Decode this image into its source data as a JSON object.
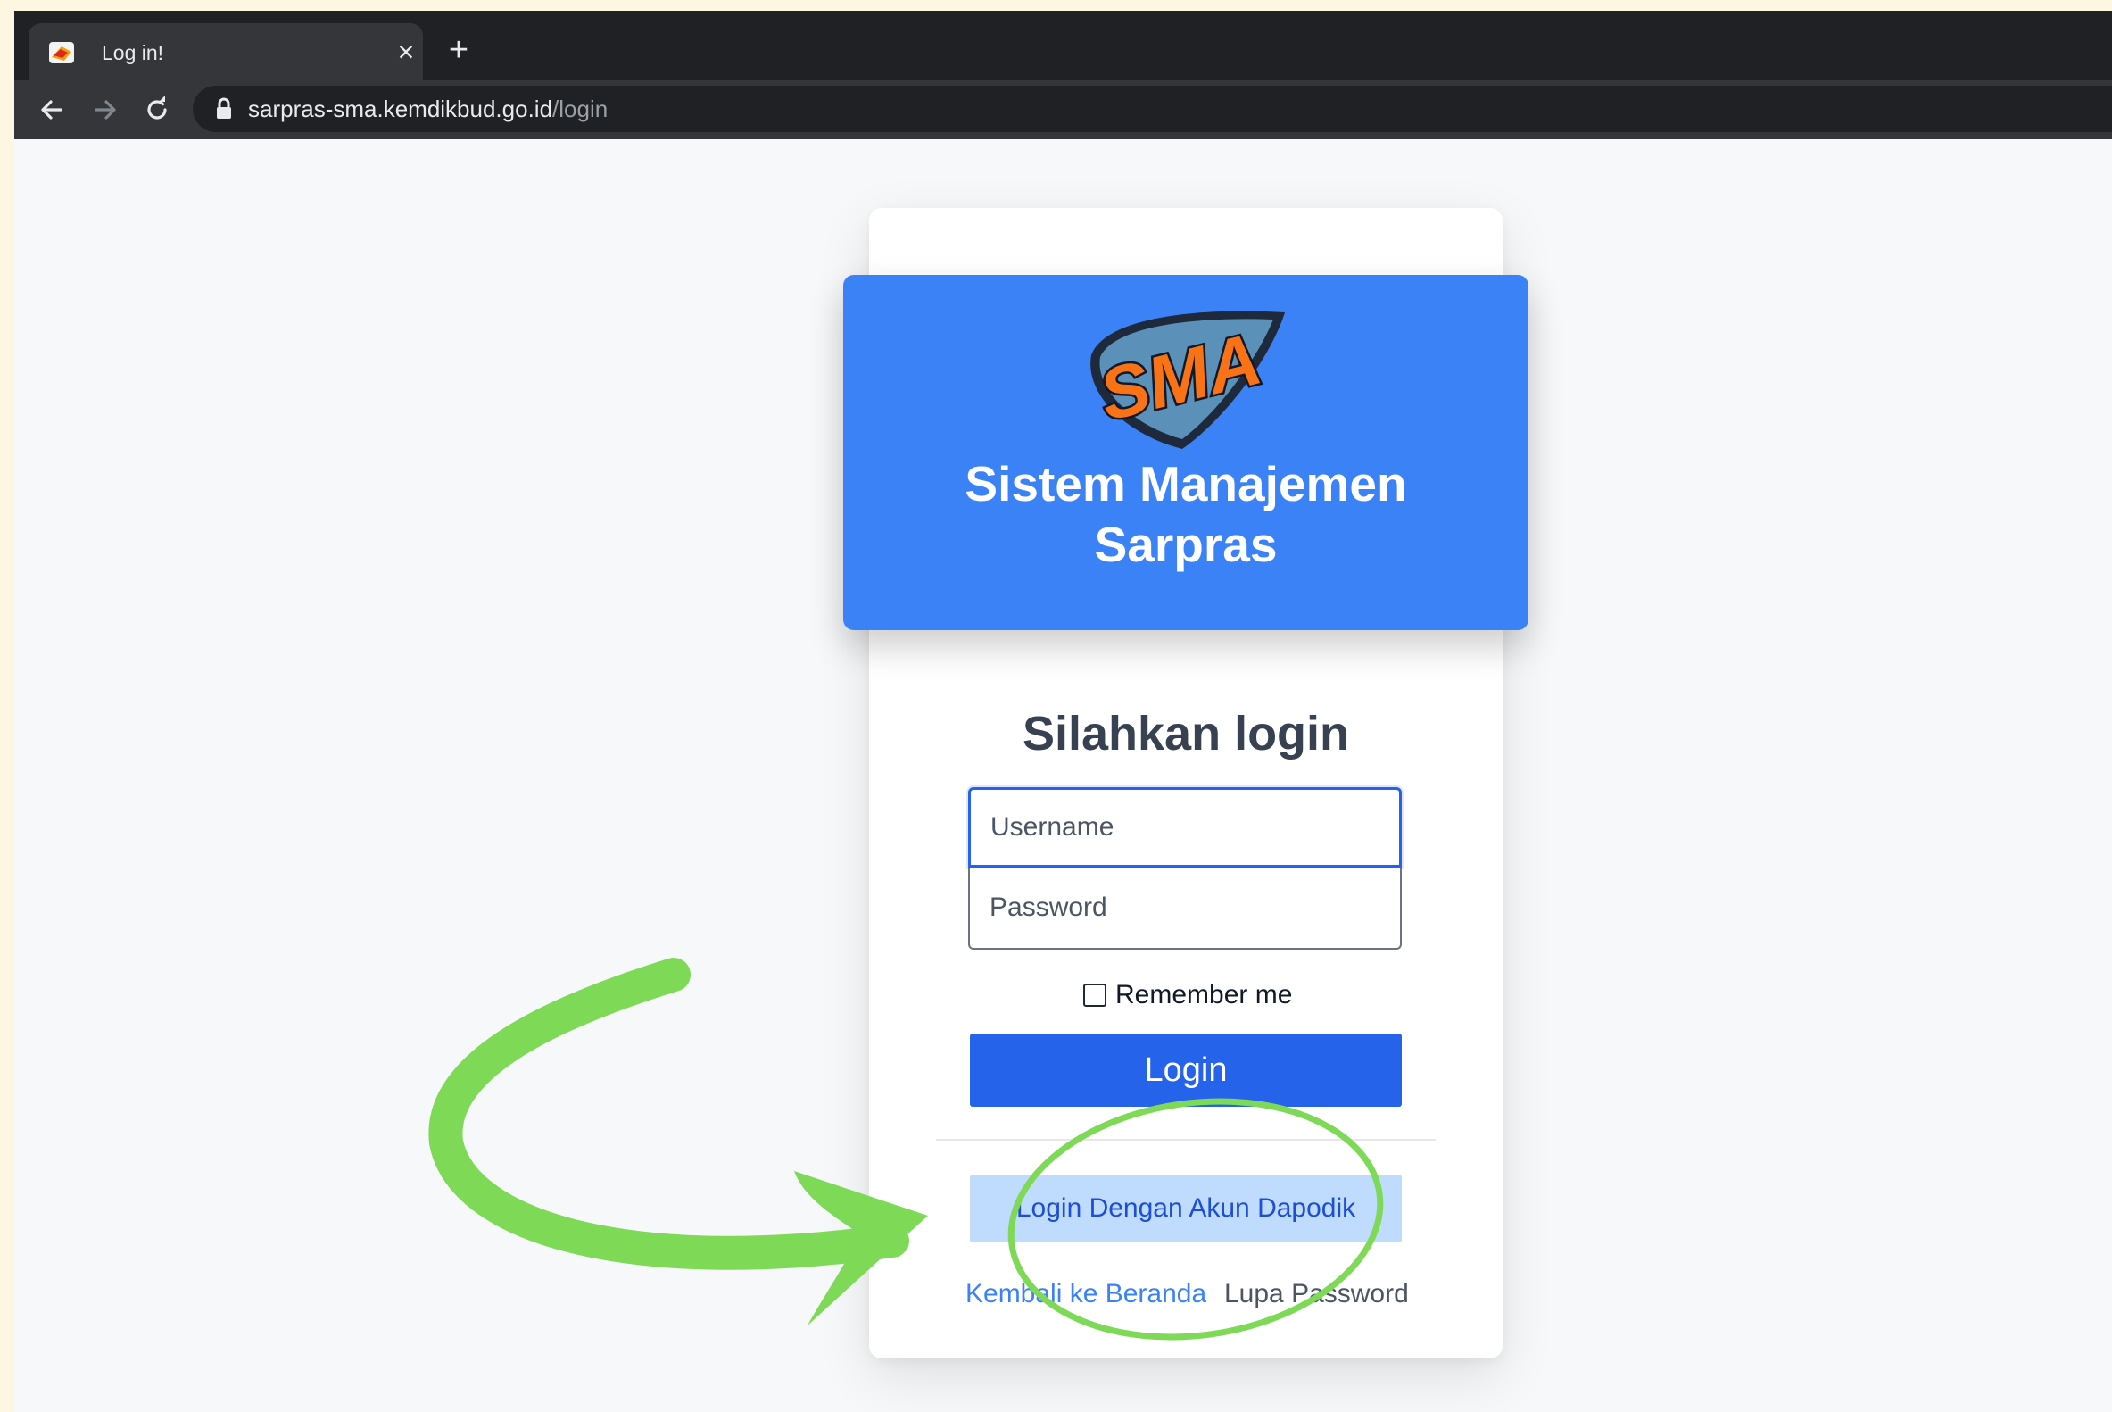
{
  "browser": {
    "tab": {
      "title": "Log in!",
      "close": "×"
    },
    "new_tab": "+",
    "url": {
      "host": "sarpras-sma.kemdikbud.go.id",
      "path": "/login"
    }
  },
  "header": {
    "logo_text": "SMA",
    "title_line1": "Sistem Manajemen",
    "title_line2": "Sarpras"
  },
  "form": {
    "heading": "Silahkan login",
    "username": {
      "value": "",
      "placeholder": "Username"
    },
    "password": {
      "value": "",
      "placeholder": "Password"
    },
    "remember_label": "Remember me",
    "login_label": "Login",
    "dapodik_label": "Login Dengan Akun Dapodik",
    "home_link": "Kembali ke Beranda",
    "forgot_link": "Lupa Password"
  },
  "colors": {
    "header_bg": "#3b82f6",
    "primary_button": "#2563eb",
    "secondary_button": "#bfdbfe",
    "annotation": "#7ed957"
  },
  "icons": [
    "favicon-icon",
    "close-icon",
    "plus-icon",
    "back-arrow-icon",
    "forward-arrow-icon",
    "reload-icon",
    "lock-icon",
    "annotation-arrow-icon",
    "annotation-circle-icon"
  ]
}
